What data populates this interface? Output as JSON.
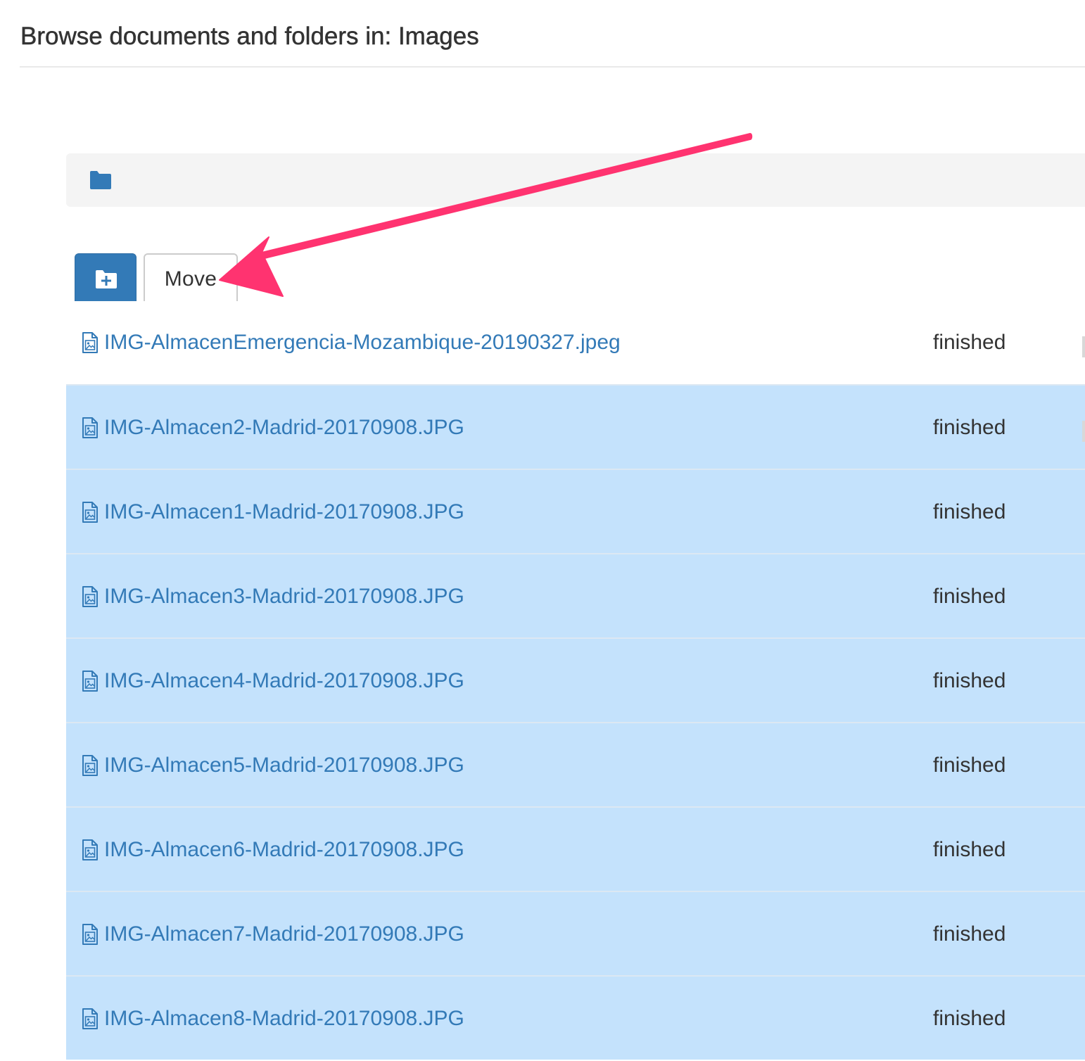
{
  "page": {
    "title": "Browse documents and folders in: Images"
  },
  "breadcrumb": {
    "icon": "folder-icon"
  },
  "toolbar": {
    "new_folder_icon": "folder-plus-icon",
    "move_label": "Move"
  },
  "files": [
    {
      "name": "IMG-AlmacenEmergencia-Mozambique-20190327.jpeg",
      "status": "finished",
      "selected": false
    },
    {
      "name": "IMG-Almacen2-Madrid-20170908.JPG",
      "status": "finished",
      "selected": true
    },
    {
      "name": "IMG-Almacen1-Madrid-20170908.JPG",
      "status": "finished",
      "selected": true
    },
    {
      "name": "IMG-Almacen3-Madrid-20170908.JPG",
      "status": "finished",
      "selected": true
    },
    {
      "name": "IMG-Almacen4-Madrid-20170908.JPG",
      "status": "finished",
      "selected": true
    },
    {
      "name": "IMG-Almacen5-Madrid-20170908.JPG",
      "status": "finished",
      "selected": true
    },
    {
      "name": "IMG-Almacen6-Madrid-20170908.JPG",
      "status": "finished",
      "selected": true
    },
    {
      "name": "IMG-Almacen7-Madrid-20170908.JPG",
      "status": "finished",
      "selected": true
    },
    {
      "name": "IMG-Almacen8-Madrid-20170908.JPG",
      "status": "finished",
      "selected": true
    }
  ],
  "colors": {
    "primary": "#337ab7",
    "selected_row": "#c4e2fc",
    "annotation_arrow": "#ff3370"
  }
}
